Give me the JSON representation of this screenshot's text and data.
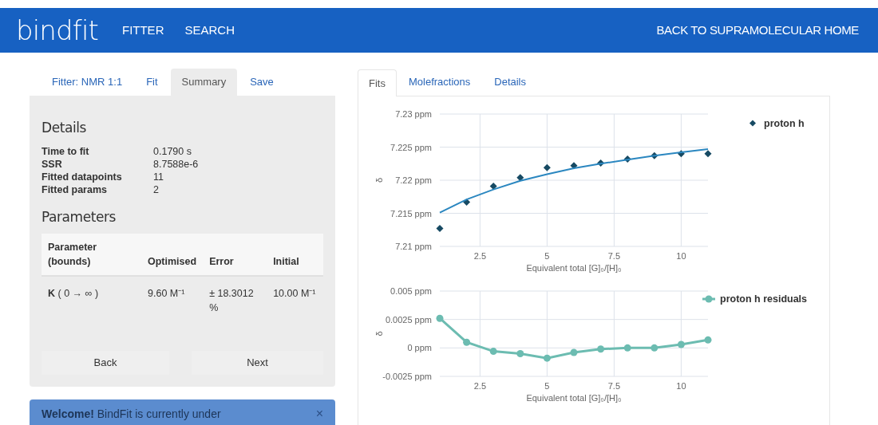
{
  "header": {
    "brand": "bindfit",
    "nav": [
      {
        "label": "FITTER"
      },
      {
        "label": "SEARCH"
      }
    ],
    "home_link": "BACK TO SUPRAMOLECULAR HOME"
  },
  "left_panel": {
    "tabs": [
      {
        "label": "Fitter: NMR 1:1",
        "selected": false
      },
      {
        "label": "Fit",
        "selected": false
      },
      {
        "label": "Summary",
        "selected": true
      },
      {
        "label": "Save",
        "selected": false
      }
    ],
    "details_heading": "Details",
    "details": [
      {
        "label": "Time to fit",
        "value": "0.1790 s"
      },
      {
        "label": "SSR",
        "value": "8.7588e-6"
      },
      {
        "label": "Fitted datapoints",
        "value": "11"
      },
      {
        "label": "Fitted params",
        "value": "2"
      }
    ],
    "parameters_heading": "Parameters",
    "table": {
      "columns": [
        "Parameter (bounds)",
        "Optimised",
        "Error",
        "Initial"
      ],
      "rows": [
        [
          "**K** ( 0 → ∞ )",
          "9.60 M⁻¹",
          "± 18.3012 %",
          "10.00 M⁻¹"
        ]
      ]
    },
    "buttons": [
      "Back",
      "Next"
    ]
  },
  "alert": {
    "text": "**Welcome!** BindFit is currently under",
    "close": "×"
  },
  "right_panel": {
    "tabs": [
      {
        "label": "Fits",
        "selected": true
      },
      {
        "label": "Molefractions",
        "selected": false
      },
      {
        "label": "Details",
        "selected": false
      }
    ],
    "charts": [
      {
        "chart_data": {
          "type": "scatter",
          "grid": true,
          "xlabel": "Equivalent total [G]₀/[H]₀",
          "ylabel": "δ",
          "x": [
            1,
            2,
            3,
            4,
            5,
            6,
            7,
            8,
            9,
            10,
            11
          ],
          "xlim": [
            1,
            11
          ],
          "ylim": [
            7.21,
            7.23
          ],
          "xticks": [
            2.5,
            5,
            7.5,
            10
          ],
          "yticks": [
            {
              "value": 7.21,
              "label": "7.21 ppm"
            },
            {
              "value": 7.215,
              "label": "7.215 ppm"
            },
            {
              "value": 7.22,
              "label": "7.22 ppm"
            },
            {
              "value": 7.225,
              "label": "7.225 ppm"
            },
            {
              "value": 7.23,
              "label": "7.23 ppm"
            }
          ],
          "series": [
            {
              "name": "proton h",
              "marker": "diamond",
              "color": "#174a63",
              "values": [
                7.2127,
                7.2167,
                7.2191,
                7.2204,
                7.2219,
                7.2222,
                7.2226,
                7.2232,
                7.2237,
                7.224,
                7.224
              ]
            },
            {
              "type": "line",
              "marker": "none",
              "color": "#2b87c0",
              "values": [
                7.2151,
                7.2171,
                7.2186,
                7.2199,
                7.2209,
                7.2218,
                7.2225,
                7.2231,
                7.2237,
                7.2242,
                7.2247
              ]
            }
          ]
        }
      },
      {
        "chart_data": {
          "type": "line",
          "grid": true,
          "xlabel": "Equivalent total [G]₀/[H]₀",
          "ylabel": "δ",
          "x": [
            1,
            2,
            3,
            4,
            5,
            6,
            7,
            8,
            9,
            10,
            11
          ],
          "xlim": [
            1,
            11
          ],
          "ylim": [
            -0.0025,
            0.005
          ],
          "xticks": [
            2.5,
            5,
            7.5,
            10
          ],
          "yticks": [
            {
              "value": -0.0025,
              "label": "-0.0025 ppm"
            },
            {
              "value": 0,
              "label": "0 ppm"
            },
            {
              "value": 0.0025,
              "label": "0.0025 ppm"
            },
            {
              "value": 0.005,
              "label": "0.005 ppm"
            }
          ],
          "series": [
            {
              "name": "proton h residuals",
              "marker": "circle",
              "color": "#6cbcb1",
              "values": [
                0.0026,
                0.0005,
                -0.0003,
                -0.0005,
                -0.0009,
                -0.0004,
                -0.0001,
                0,
                0,
                0.0003,
                0.0007
              ]
            }
          ]
        }
      }
    ]
  }
}
